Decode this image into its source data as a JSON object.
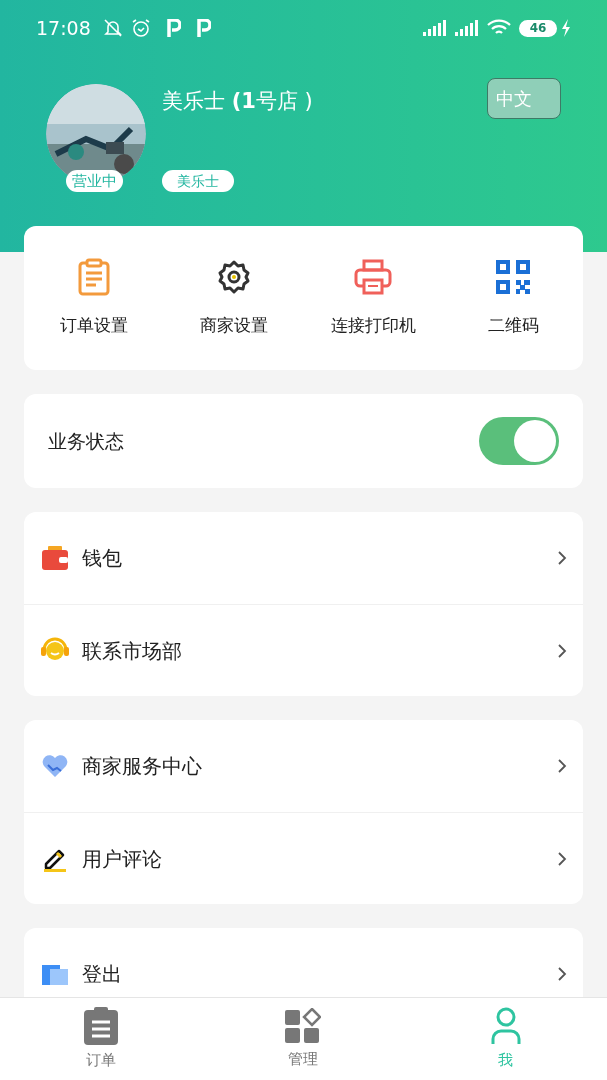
{
  "status_bar": {
    "time": "17:08",
    "battery": "46"
  },
  "profile": {
    "store_name": "美乐士 **(1**号店 )",
    "status_badge": "营业中",
    "brand_tag": "美乐士",
    "language_button": "中文"
  },
  "quick_actions": [
    {
      "kind": "clipboard",
      "label": "订单设置"
    },
    {
      "kind": "gear",
      "label": "商家设置"
    },
    {
      "kind": "printer",
      "label": "连接打印机"
    },
    {
      "kind": "qr",
      "label": "二维码"
    }
  ],
  "business_status": {
    "label": "业务状态",
    "on": true
  },
  "menu_groups": [
    [
      {
        "kind": "wallet",
        "label": "钱包"
      },
      {
        "kind": "headset",
        "label": "联系市场部"
      }
    ],
    [
      {
        "kind": "handshake",
        "label": "商家服务中心"
      },
      {
        "kind": "pen",
        "label": "用户评论"
      }
    ],
    [
      {
        "kind": "logout",
        "label": "登出"
      }
    ]
  ],
  "tabs": [
    {
      "kind": "orders",
      "label": "订单",
      "selected": false
    },
    {
      "kind": "manage",
      "label": "管理",
      "selected": false
    },
    {
      "kind": "me",
      "label": "我",
      "selected": true
    }
  ]
}
